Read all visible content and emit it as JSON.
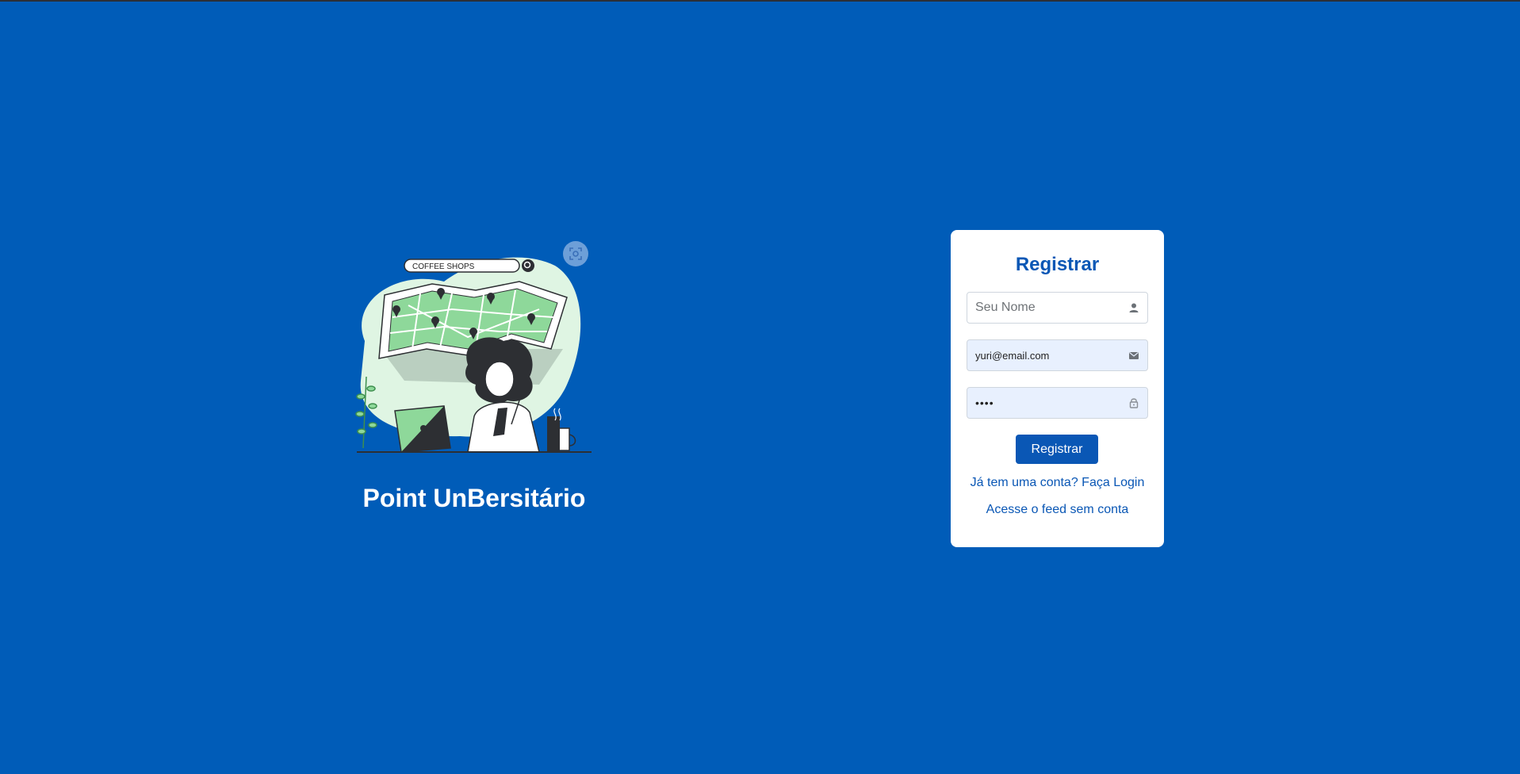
{
  "hero": {
    "search_text": "COFFEE SHOPS",
    "title": "Point UnBersitário",
    "scan_icon": "scan-icon"
  },
  "register": {
    "title": "Registrar",
    "name_placeholder": "Seu Nome",
    "name_icon": "user-icon",
    "email_value": "yuri@email.com",
    "email_icon": "envelope-icon",
    "password_value": "••••",
    "password_icon": "lock-icon",
    "submit_label": "Registrar",
    "login_link": "Já tem uma conta? Faça Login",
    "feed_link": "Acesse o feed sem conta"
  },
  "colors": {
    "background": "#005cb8",
    "accent": "#0a57b5",
    "card": "#ffffff",
    "map_green": "#8ed89a",
    "blob": "#dff5e3"
  }
}
